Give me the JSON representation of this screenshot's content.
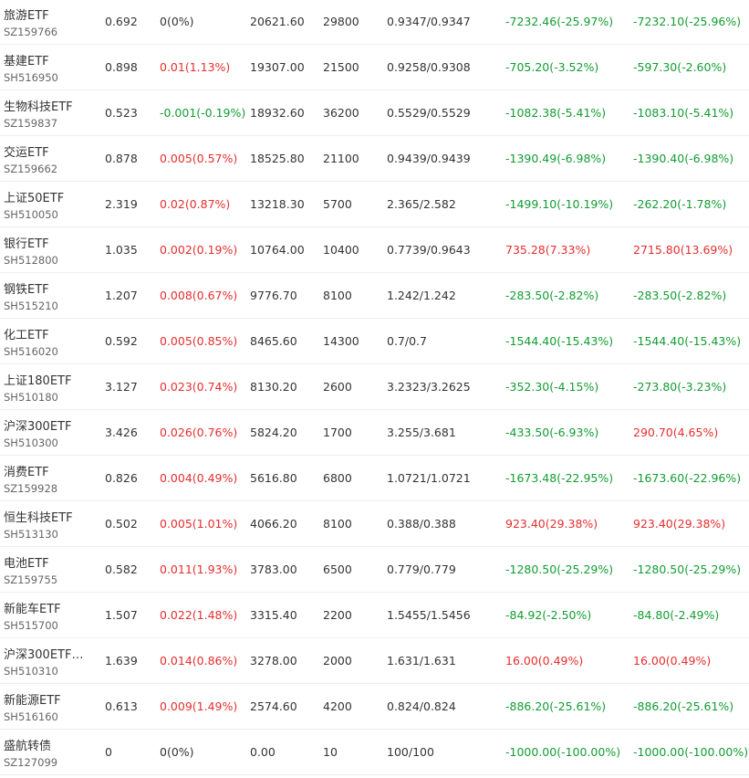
{
  "colors": {
    "up": "#e62e2e",
    "down": "#139c32",
    "flat": "#333333",
    "divider": "#eeeeee"
  },
  "rows": [
    {
      "name": "旅游ETF",
      "code": "SZ159766",
      "price": "0.692",
      "change": "0(0%)",
      "change_dir": "flat",
      "value": "20621.60",
      "qty": "29800",
      "cost": "0.9347/0.9347",
      "pl": "-7232.46(-25.97%)",
      "pl_dir": "down",
      "pl2": "-7232.10(-25.96%)",
      "pl2_dir": "down"
    },
    {
      "name": "基建ETF",
      "code": "SH516950",
      "price": "0.898",
      "change": "0.01(1.13%)",
      "change_dir": "up",
      "value": "19307.00",
      "qty": "21500",
      "cost": "0.9258/0.9308",
      "pl": "-705.20(-3.52%)",
      "pl_dir": "down",
      "pl2": "-597.30(-2.60%)",
      "pl2_dir": "down"
    },
    {
      "name": "生物科技ETF",
      "code": "SZ159837",
      "price": "0.523",
      "change": "-0.001(-0.19%)",
      "change_dir": "down",
      "value": "18932.60",
      "qty": "36200",
      "cost": "0.5529/0.5529",
      "pl": "-1082.38(-5.41%)",
      "pl_dir": "down",
      "pl2": "-1083.10(-5.41%)",
      "pl2_dir": "down"
    },
    {
      "name": "交运ETF",
      "code": "SZ159662",
      "price": "0.878",
      "change": "0.005(0.57%)",
      "change_dir": "up",
      "value": "18525.80",
      "qty": "21100",
      "cost": "0.9439/0.9439",
      "pl": "-1390.49(-6.98%)",
      "pl_dir": "down",
      "pl2": "-1390.40(-6.98%)",
      "pl2_dir": "down"
    },
    {
      "name": "上证50ETF",
      "code": "SH510050",
      "price": "2.319",
      "change": "0.02(0.87%)",
      "change_dir": "up",
      "value": "13218.30",
      "qty": "5700",
      "cost": "2.365/2.582",
      "pl": "-1499.10(-10.19%)",
      "pl_dir": "down",
      "pl2": "-262.20(-1.78%)",
      "pl2_dir": "down"
    },
    {
      "name": "银行ETF",
      "code": "SH512800",
      "price": "1.035",
      "change": "0.002(0.19%)",
      "change_dir": "up",
      "value": "10764.00",
      "qty": "10400",
      "cost": "0.7739/0.9643",
      "pl": "735.28(7.33%)",
      "pl_dir": "up",
      "pl2": "2715.80(13.69%)",
      "pl2_dir": "up"
    },
    {
      "name": "钢铁ETF",
      "code": "SH515210",
      "price": "1.207",
      "change": "0.008(0.67%)",
      "change_dir": "up",
      "value": "9776.70",
      "qty": "8100",
      "cost": "1.242/1.242",
      "pl": "-283.50(-2.82%)",
      "pl_dir": "down",
      "pl2": "-283.50(-2.82%)",
      "pl2_dir": "down"
    },
    {
      "name": "化工ETF",
      "code": "SH516020",
      "price": "0.592",
      "change": "0.005(0.85%)",
      "change_dir": "up",
      "value": "8465.60",
      "qty": "14300",
      "cost": "0.7/0.7",
      "pl": "-1544.40(-15.43%)",
      "pl_dir": "down",
      "pl2": "-1544.40(-15.43%)",
      "pl2_dir": "down"
    },
    {
      "name": "上证180ETF",
      "code": "SH510180",
      "price": "3.127",
      "change": "0.023(0.74%)",
      "change_dir": "up",
      "value": "8130.20",
      "qty": "2600",
      "cost": "3.2323/3.2625",
      "pl": "-352.30(-4.15%)",
      "pl_dir": "down",
      "pl2": "-273.80(-3.23%)",
      "pl2_dir": "down"
    },
    {
      "name": "沪深300ETF",
      "code": "SH510300",
      "price": "3.426",
      "change": "0.026(0.76%)",
      "change_dir": "up",
      "value": "5824.20",
      "qty": "1700",
      "cost": "3.255/3.681",
      "pl": "-433.50(-6.93%)",
      "pl_dir": "down",
      "pl2": "290.70(4.65%)",
      "pl2_dir": "up"
    },
    {
      "name": "消费ETF",
      "code": "SZ159928",
      "price": "0.826",
      "change": "0.004(0.49%)",
      "change_dir": "up",
      "value": "5616.80",
      "qty": "6800",
      "cost": "1.0721/1.0721",
      "pl": "-1673.48(-22.95%)",
      "pl_dir": "down",
      "pl2": "-1673.60(-22.96%)",
      "pl2_dir": "down"
    },
    {
      "name": "恒生科技ETF",
      "code": "SH513130",
      "price": "0.502",
      "change": "0.005(1.01%)",
      "change_dir": "up",
      "value": "4066.20",
      "qty": "8100",
      "cost": "0.388/0.388",
      "pl": "923.40(29.38%)",
      "pl_dir": "up",
      "pl2": "923.40(29.38%)",
      "pl2_dir": "up"
    },
    {
      "name": "电池ETF",
      "code": "SZ159755",
      "price": "0.582",
      "change": "0.011(1.93%)",
      "change_dir": "up",
      "value": "3783.00",
      "qty": "6500",
      "cost": "0.779/0.779",
      "pl": "-1280.50(-25.29%)",
      "pl_dir": "down",
      "pl2": "-1280.50(-25.29%)",
      "pl2_dir": "down"
    },
    {
      "name": "新能车ETF",
      "code": "SH515700",
      "price": "1.507",
      "change": "0.022(1.48%)",
      "change_dir": "up",
      "value": "3315.40",
      "qty": "2200",
      "cost": "1.5455/1.5456",
      "pl": "-84.92(-2.50%)",
      "pl_dir": "down",
      "pl2": "-84.80(-2.49%)",
      "pl2_dir": "down"
    },
    {
      "name": "沪深300ETF…",
      "code": "SH510310",
      "price": "1.639",
      "change": "0.014(0.86%)",
      "change_dir": "up",
      "value": "3278.00",
      "qty": "2000",
      "cost": "1.631/1.631",
      "pl": "16.00(0.49%)",
      "pl_dir": "up",
      "pl2": "16.00(0.49%)",
      "pl2_dir": "up"
    },
    {
      "name": "新能源ETF",
      "code": "SH516160",
      "price": "0.613",
      "change": "0.009(1.49%)",
      "change_dir": "up",
      "value": "2574.60",
      "qty": "4200",
      "cost": "0.824/0.824",
      "pl": "-886.20(-25.61%)",
      "pl_dir": "down",
      "pl2": "-886.20(-25.61%)",
      "pl2_dir": "down"
    },
    {
      "name": "盛航转债",
      "code": "SZ127099",
      "price": "0",
      "change": "0(0%)",
      "change_dir": "flat",
      "value": "0.00",
      "qty": "10",
      "cost": "100/100",
      "pl": "-1000.00(-100.00%)",
      "pl_dir": "down",
      "pl2": "-1000.00(-100.00%)",
      "pl2_dir": "down"
    }
  ]
}
